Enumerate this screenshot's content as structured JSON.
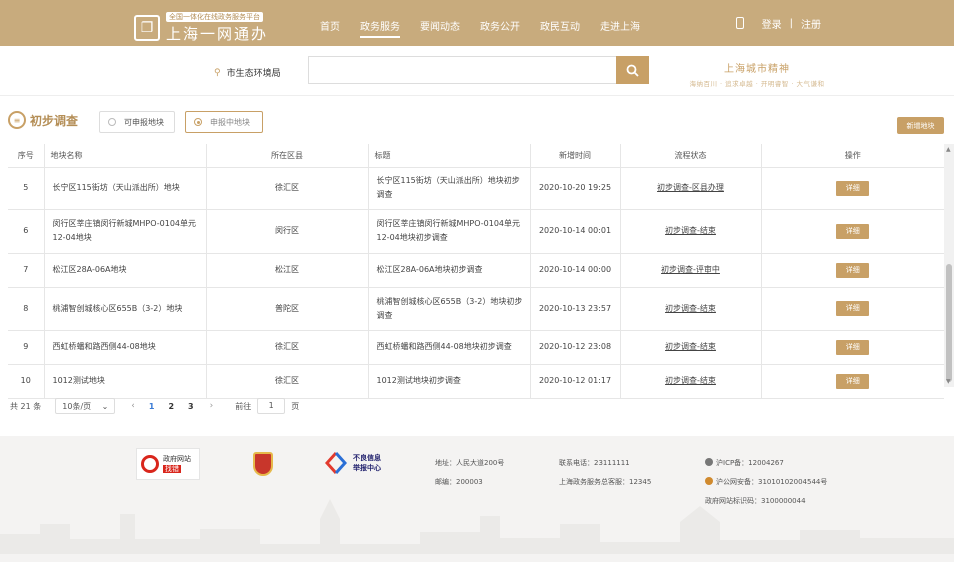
{
  "header": {
    "logo_sub": "全国一体化在线政务服务平台",
    "logo_main": "上海一网通办",
    "nav": [
      "首页",
      "政务服务",
      "要闻动态",
      "政务公开",
      "政民互动",
      "走进上海"
    ],
    "active_nav": 1,
    "login": "登录",
    "sep": "|",
    "register": "注册"
  },
  "search": {
    "location": "市生态环境局",
    "placeholder": "",
    "brand_title": "上海城市精神",
    "brand_sub": "海纳百川 · 追求卓越 · 开明睿智 · 大气谦和"
  },
  "page": {
    "title": "初步调查",
    "filters": [
      "可申报地块",
      "申报中地块"
    ],
    "add_button": "新增地块"
  },
  "table": {
    "headers": [
      "序号",
      "地块名称",
      "所在区县",
      "标题",
      "新增时间",
      "流程状态",
      "操作"
    ],
    "rows": [
      {
        "no": "5",
        "name": "长宁区115街坊（天山派出所）地块",
        "district": "徐汇区",
        "title": "长宁区115街坊（天山派出所）地块初步调查",
        "time": "2020-10-20 19:25",
        "status": "初步调查-区县办理",
        "action": "详细"
      },
      {
        "no": "6",
        "name": "闵行区莘庄镇闵行新城MHPO-0104单元12-04地块",
        "district": "闵行区",
        "title": "闵行区莘庄镇闵行新城MHPO-0104单元12-04地块初步调查",
        "time": "2020-10-14 00:01",
        "status": "初步调查-结束",
        "action": "详细"
      },
      {
        "no": "7",
        "name": "松江区28A-06A地块",
        "district": "松江区",
        "title": "松江区28A-06A地块初步调查",
        "time": "2020-10-14 00:00",
        "status": "初步调查-评审中",
        "action": "详细"
      },
      {
        "no": "8",
        "name": "桃浦智创城核心区655B（3-2）地块",
        "district": "普陀区",
        "title": "桃浦智创城核心区655B（3-2）地块初步调查",
        "time": "2020-10-13 23:57",
        "status": "初步调查-结束",
        "action": "详细"
      },
      {
        "no": "9",
        "name": "西虹桥蟠和路西侧44-08地块",
        "district": "徐汇区",
        "title": "西虹桥蟠和路西侧44-08地块初步调查",
        "time": "2020-10-12 23:08",
        "status": "初步调查-结束",
        "action": "详细"
      },
      {
        "no": "10",
        "name": "1012测试地块",
        "district": "徐汇区",
        "title": "1012测试地块初步调查",
        "time": "2020-10-12 01:17",
        "status": "初步调查-结束",
        "action": "详细"
      }
    ]
  },
  "pager": {
    "total": "共 21 条",
    "page_size": "10条/页",
    "pages": [
      "1",
      "2",
      "3"
    ],
    "current": "1",
    "goto_label": "前往",
    "goto_value": "1",
    "page_suffix": "页"
  },
  "footer": {
    "badge1_line1": "政府网站",
    "badge1_line2": "找错",
    "report_line1": "不良信息",
    "report_line2": "举报中心",
    "address": "地址：人民大道200号",
    "postcode": "邮编：200003",
    "phone": "联系电话：23111111",
    "hotline": "上海政务服务总客服：12345",
    "icp": "沪ICP备：12004267",
    "police": "沪公网安备：31010102004544号",
    "site_id": "政府网站标识码：3100000044"
  },
  "colors": {
    "brand": "#c8ab7d",
    "accent": "#c8a066",
    "link": "#3a7bd5"
  }
}
